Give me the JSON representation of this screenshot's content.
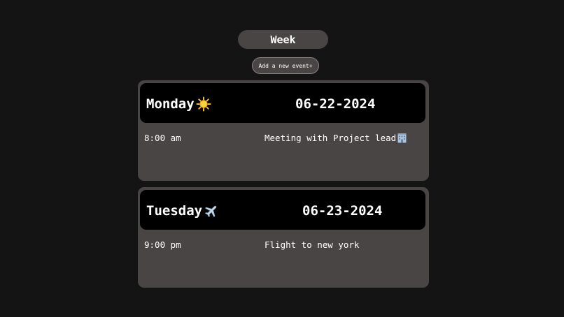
{
  "header": {
    "title": "Week",
    "add_button_label": "Add a new event+"
  },
  "days": [
    {
      "name": "Monday",
      "icon": "sun-icon",
      "date": "06-22-2024",
      "events": [
        {
          "time": "8:00 am",
          "title": "Meeting with Project lead",
          "icon": "office-building-icon"
        }
      ]
    },
    {
      "name": "Tuesday",
      "icon": "airplane-icon",
      "date": "06-23-2024",
      "events": [
        {
          "time": "9:00 pm",
          "title": "Flight to new york"
        }
      ]
    }
  ],
  "colors": {
    "background": "#141414",
    "card": "#4a4545",
    "card_header": "#000000",
    "text": "#ffffff",
    "sun": "#f5b82e",
    "airplane": "#8fb8de"
  }
}
